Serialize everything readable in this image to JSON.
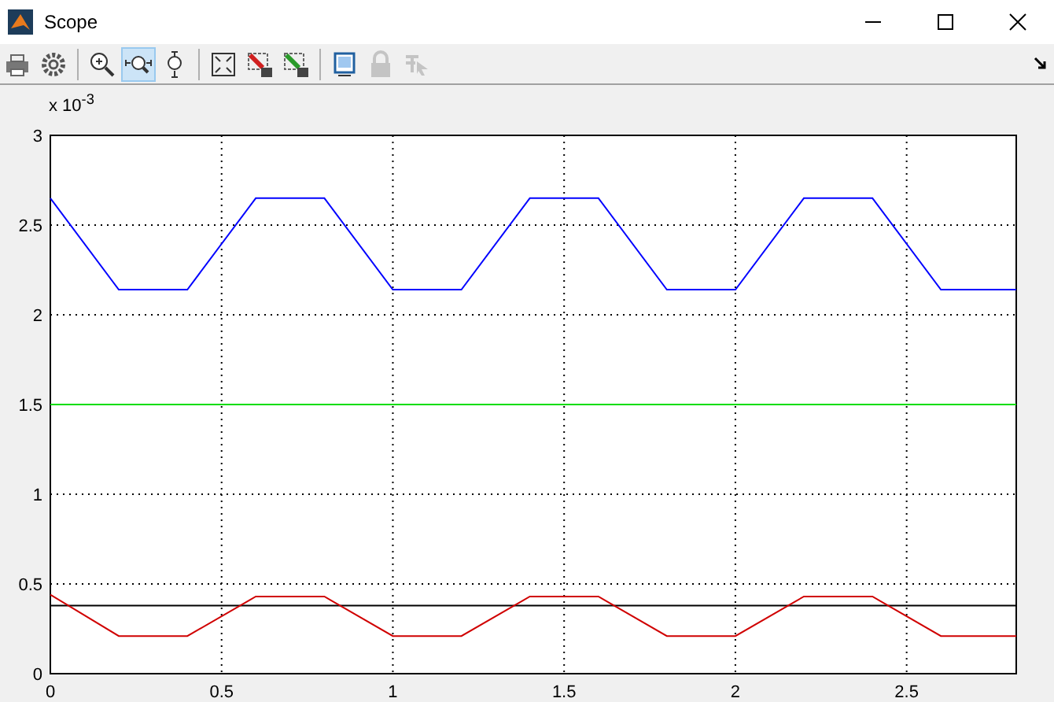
{
  "window": {
    "title": "Scope"
  },
  "toolbar": [
    {
      "kind": "print",
      "selected": false,
      "disabled": false
    },
    {
      "kind": "settings",
      "selected": false,
      "disabled": false
    },
    {
      "kind": "sep"
    },
    {
      "kind": "zoom",
      "selected": false,
      "disabled": false
    },
    {
      "kind": "zoomx",
      "selected": true,
      "disabled": false
    },
    {
      "kind": "zoomy",
      "selected": false,
      "disabled": false
    },
    {
      "kind": "sep"
    },
    {
      "kind": "autoscale",
      "selected": false,
      "disabled": false
    },
    {
      "kind": "save",
      "selected": false,
      "disabled": false
    },
    {
      "kind": "restore",
      "selected": false,
      "disabled": false
    },
    {
      "kind": "sep"
    },
    {
      "kind": "float",
      "selected": false,
      "disabled": false
    },
    {
      "kind": "lock",
      "selected": false,
      "disabled": true
    },
    {
      "kind": "select",
      "selected": false,
      "disabled": true
    }
  ],
  "plot": {
    "y_multiplier": "x 10$^{-3}$",
    "chart_data": {
      "type": "line",
      "x": [
        0,
        0.2,
        0.4,
        0.6,
        0.8,
        1.0,
        1.2,
        1.4,
        1.6,
        1.8,
        2.0,
        2.2,
        2.4,
        2.6,
        2.82
      ],
      "series": [
        {
          "color": "#0000ff",
          "values": [
            2.65,
            2.14,
            2.14,
            2.65,
            2.65,
            2.14,
            2.14,
            2.65,
            2.65,
            2.14,
            2.14,
            2.65,
            2.65,
            2.14,
            2.14
          ]
        },
        {
          "color": "#00dd00",
          "values": [
            1.5,
            1.5,
            1.5,
            1.5,
            1.5,
            1.5,
            1.5,
            1.5,
            1.5,
            1.5,
            1.5,
            1.5,
            1.5,
            1.5,
            1.5
          ]
        },
        {
          "color": "#000000",
          "values": [
            0.38,
            0.38,
            0.38,
            0.38,
            0.38,
            0.38,
            0.38,
            0.38,
            0.38,
            0.38,
            0.38,
            0.38,
            0.38,
            0.38,
            0.38
          ]
        },
        {
          "color": "#d00000",
          "values": [
            0.44,
            0.21,
            0.21,
            0.43,
            0.43,
            0.21,
            0.21,
            0.43,
            0.43,
            0.21,
            0.21,
            0.43,
            0.43,
            0.21,
            0.21
          ]
        }
      ],
      "xlim": [
        0,
        2.82
      ],
      "ylim": [
        0,
        3
      ],
      "xticks": [
        0,
        0.5,
        1,
        1.5,
        2,
        2.5
      ],
      "yticks": [
        0,
        0.5,
        1,
        1.5,
        2,
        2.5,
        3
      ]
    }
  }
}
